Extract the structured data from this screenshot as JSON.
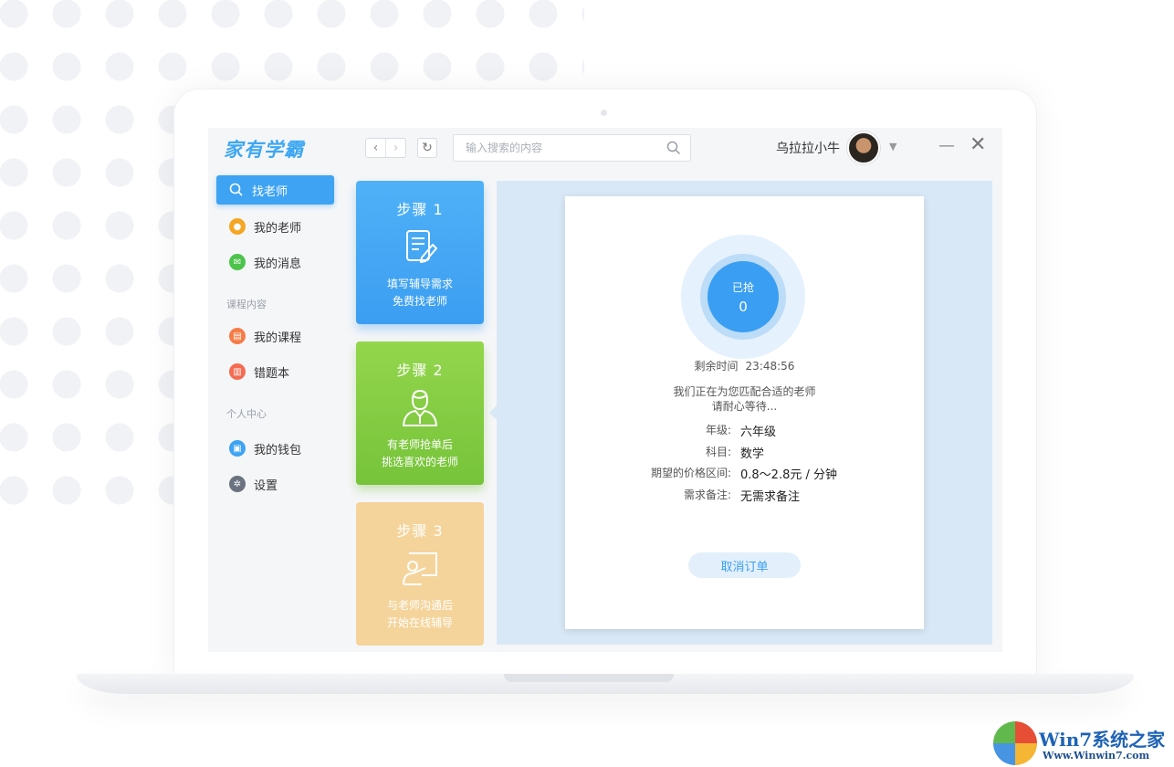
{
  "app": {
    "logo": "家有学霸",
    "search_placeholder": "输入搜索的内容",
    "username": "乌拉拉小牛",
    "nav_back": "‹",
    "nav_forward": "›",
    "refresh": "↻",
    "dropdown": "▼",
    "minimize": "—",
    "close": "✕"
  },
  "sidebar": {
    "items": [
      {
        "label": "找老师",
        "icon": "search-icon",
        "active": true
      },
      {
        "label": "我的老师",
        "icon": "teacher-icon",
        "color": "#f5a623"
      },
      {
        "label": "我的消息",
        "icon": "message-icon",
        "color": "#4cc34a"
      }
    ],
    "section_course": "课程内容",
    "course_items": [
      {
        "label": "我的课程",
        "icon": "course-icon",
        "color": "#f57c47"
      },
      {
        "label": "错题本",
        "icon": "notebook-icon",
        "color": "#f56c52"
      }
    ],
    "section_personal": "个人中心",
    "personal_items": [
      {
        "label": "我的钱包",
        "icon": "wallet-icon",
        "color": "#3ea3f3"
      },
      {
        "label": "设置",
        "icon": "settings-icon",
        "color": "#6b7280"
      }
    ]
  },
  "steps": [
    {
      "title": "步骤 1",
      "line1": "填写辅导需求",
      "line2": "免费找老师",
      "color": "#3ea3f3"
    },
    {
      "title": "步骤 2",
      "line1": "有老师抢单后",
      "line2": "挑选喜欢的老师",
      "color": "#7cc63e"
    },
    {
      "title": "步骤 3",
      "line1": "与老师沟通后",
      "line2": "开始在线辅导",
      "color": "#f4d49b"
    }
  ],
  "order": {
    "grabbed_label": "已抢",
    "grabbed_count": "0",
    "remaining_label": "剩余时间",
    "remaining_time": "23:48:56",
    "matching_line1": "我们正在为您匹配合适的老师",
    "matching_line2": "请耐心等待...",
    "grade_label": "年级:",
    "grade_value": "六年级",
    "subject_label": "科目:",
    "subject_value": "数学",
    "price_label": "期望的价格区间:",
    "price_value": "0.8～2.8元 / 分钟",
    "note_label": "需求备注:",
    "note_value": "无需求备注",
    "cancel_label": "取消订单"
  },
  "watermark": {
    "text": "Win7系统之家",
    "url": "Www.Winwin7.com"
  }
}
